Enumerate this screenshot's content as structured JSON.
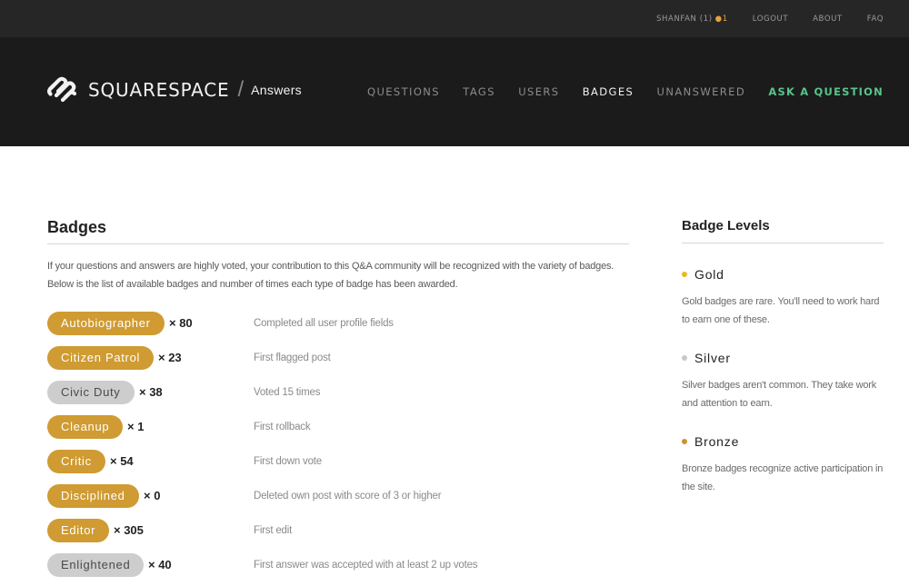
{
  "topbar": {
    "user": "SHANFAN (1)",
    "user_badge_dot": "●",
    "user_badge_count": "1",
    "logout": "LOGOUT",
    "about": "ABOUT",
    "faq": "FAQ"
  },
  "header": {
    "logo_text": "SQUARESPACE",
    "logo_slash": "/",
    "logo_sub": "Answers",
    "nav": {
      "questions": "QUESTIONS",
      "tags": "TAGS",
      "users": "USERS",
      "badges": "BADGES",
      "unanswered": "UNANSWERED",
      "ask": "ASK A QUESTION"
    }
  },
  "main": {
    "title": "Badges",
    "intro": "If your questions and answers are highly voted, your contribution to this Q&A community will be recognized with the variety of badges. Below is the list of available badges and number of times each type of badge has been awarded.",
    "badges": [
      {
        "name": "Autobiographer",
        "level": "gold",
        "count": "× 80",
        "description": "Completed all user profile fields"
      },
      {
        "name": "Citizen Patrol",
        "level": "gold",
        "count": "× 23",
        "description": "First flagged post"
      },
      {
        "name": "Civic Duty",
        "level": "silver",
        "count": "× 38",
        "description": "Voted 15 times"
      },
      {
        "name": "Cleanup",
        "level": "gold",
        "count": "× 1",
        "description": "First rollback"
      },
      {
        "name": "Critic",
        "level": "gold",
        "count": "× 54",
        "description": "First down vote"
      },
      {
        "name": "Disciplined",
        "level": "gold",
        "count": "× 0",
        "description": "Deleted own post with score of 3 or higher"
      },
      {
        "name": "Editor",
        "level": "gold",
        "count": "× 305",
        "description": "First edit"
      },
      {
        "name": "Enlightened",
        "level": "silver",
        "count": "× 40",
        "description": "First answer was accepted with at least 2 up votes"
      }
    ]
  },
  "sidebar": {
    "title": "Badge Levels",
    "levels": [
      {
        "name": "Gold",
        "color": "#e8b923",
        "description": "Gold badges are rare. You'll need to work hard to earn one of these."
      },
      {
        "name": "Silver",
        "color": "#c8c8c8",
        "description": "Silver badges aren't common. They take work and attention to earn."
      },
      {
        "name": "Bronze",
        "color": "#c9932e",
        "description": "Bronze badges recognize active participation in the site."
      }
    ]
  },
  "colors": {
    "gold_pill": "#cf9b32",
    "silver_pill": "#cdcdcd",
    "ask_accent": "#58c48b",
    "header_bg": "#1b1b1b",
    "topbar_bg": "#262626"
  }
}
